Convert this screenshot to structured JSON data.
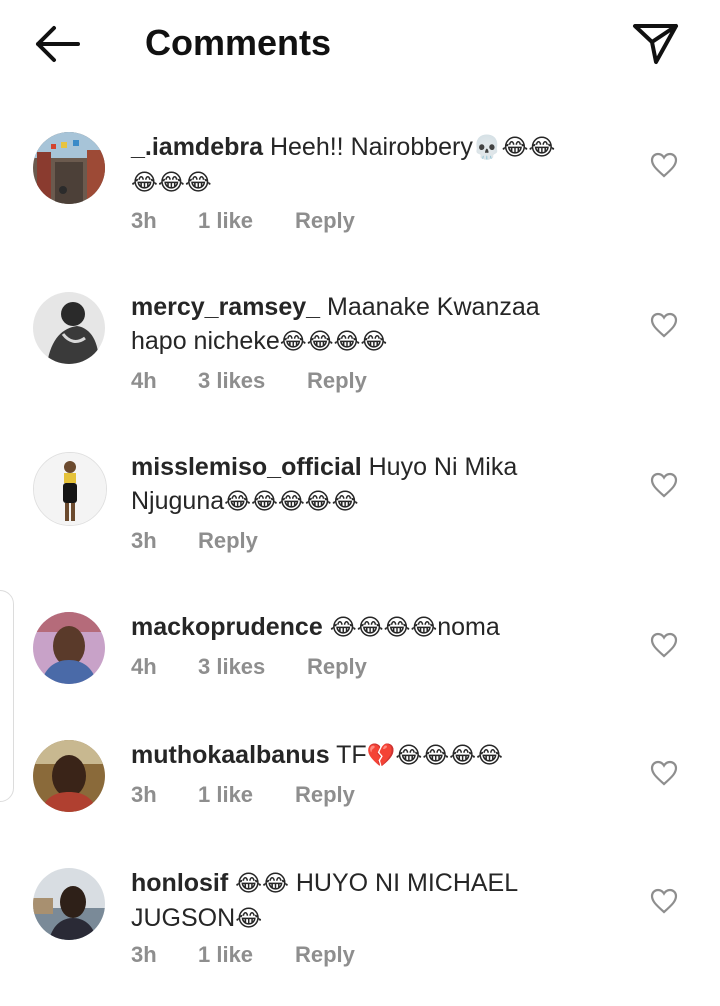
{
  "header": {
    "title": "Comments",
    "back_icon": "arrow-left-icon",
    "share_icon": "paper-plane-icon"
  },
  "comments": [
    {
      "username": "_.iamdebra",
      "text": "Heeh!! Nairobbery",
      "emojis_inline": "💀😂😂",
      "emojis_line2": "😂😂😂",
      "time": "3h",
      "likes": "1 like",
      "reply": "Reply"
    },
    {
      "username": "mercy_ramsey_",
      "text": "Maanake Kwanzaa",
      "text_line2": "hapo nicheke",
      "emojis_line2": "😂😂😂😂",
      "time": "4h",
      "likes": "3 likes",
      "reply": "Reply"
    },
    {
      "username": "misslemiso_official",
      "text": "Huyo Ni Mika",
      "text_line2": "Njuguna",
      "emojis_line2": "😂😂😂😂😂",
      "time": "3h",
      "reply": "Reply"
    },
    {
      "username": "mackoprudence",
      "emojis_inline": "😂😂😂😂",
      "text": "noma",
      "time": "4h",
      "likes": "3 likes",
      "reply": "Reply"
    },
    {
      "username": "muthokaalbanus",
      "text": "TF",
      "emojis_inline": "💔😂😂😂😂",
      "time": "3h",
      "likes": "1 like",
      "reply": "Reply"
    },
    {
      "username": "honlosif",
      "emojis_inline": "😂😂",
      "text": "HUYO NI MICHAEL",
      "text_line2": "JUGSON",
      "emojis_line2": "😂",
      "time": "3h",
      "likes": "1 like",
      "reply": "Reply"
    }
  ],
  "colors": {
    "text": "#262626",
    "meta": "#8e8e8e",
    "background": "#ffffff"
  }
}
